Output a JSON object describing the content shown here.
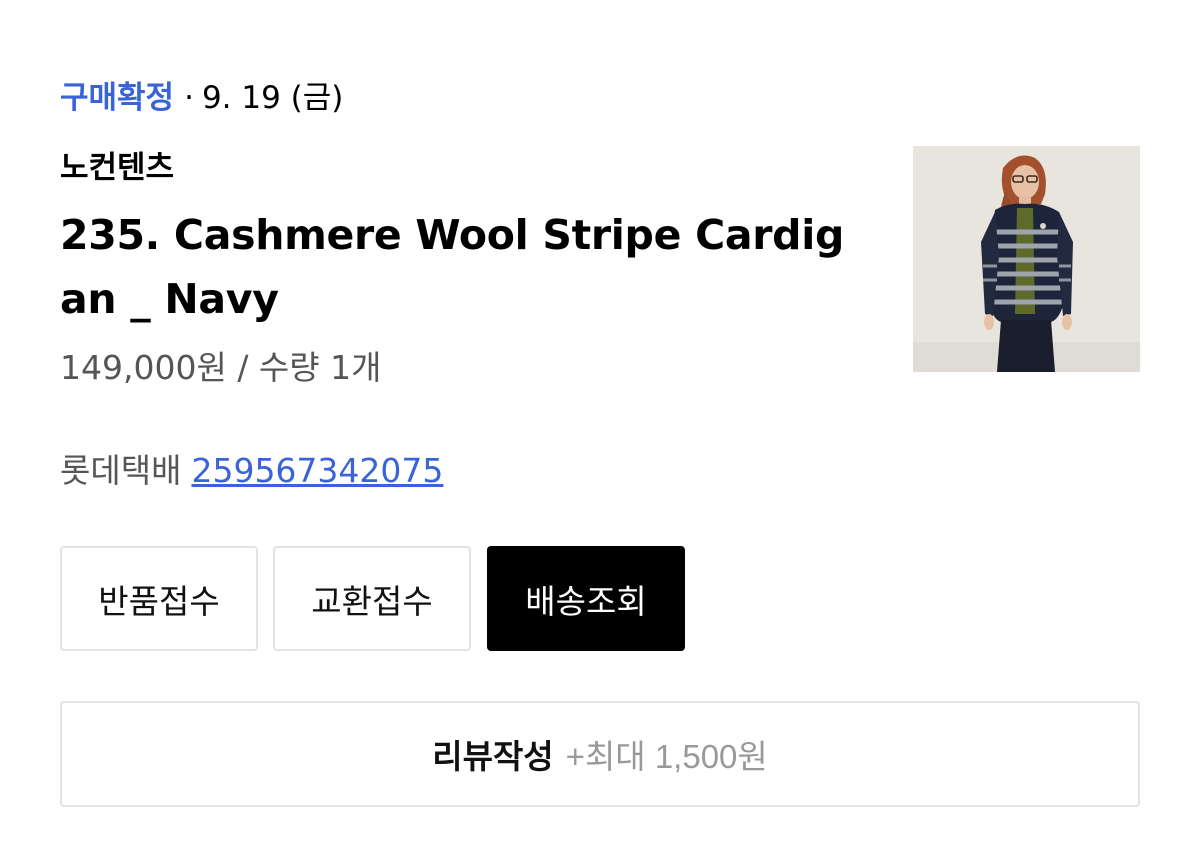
{
  "order": {
    "status": "구매확정",
    "separator": "·",
    "date": "9. 19 (금)"
  },
  "product": {
    "brand": "노컨텐츠",
    "name": "235. Cashmere Wool Stripe Cardigan _ Navy",
    "price_quantity": "149,000원 / 수량 1개",
    "image_alt": "Model wearing navy striped cardigan"
  },
  "shipping": {
    "carrier": "롯데택배",
    "tracking_number": "259567342075"
  },
  "actions": {
    "return_label": "반품접수",
    "exchange_label": "교환접수",
    "tracking_label": "배송조회"
  },
  "review": {
    "label": "리뷰작성",
    "reward": "+최대 1,500원"
  }
}
